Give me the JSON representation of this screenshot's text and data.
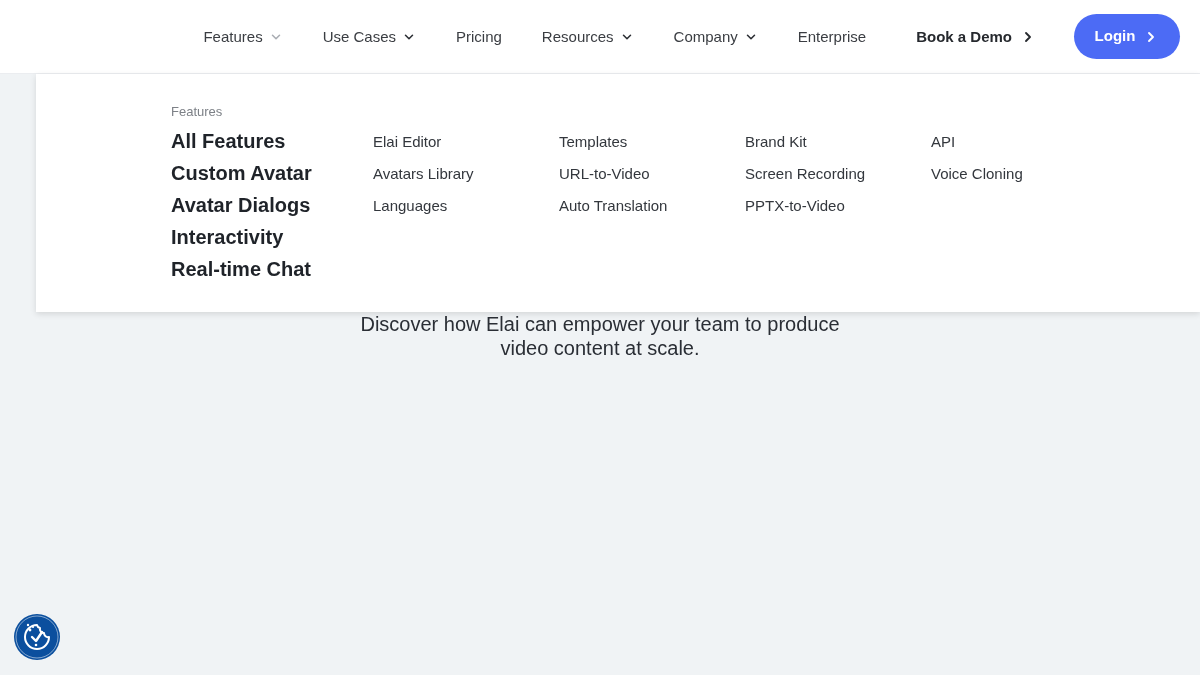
{
  "nav": {
    "items": [
      {
        "label": "Features",
        "kind": "dropdown",
        "expanded": true
      },
      {
        "label": "Use Cases",
        "kind": "dropdown",
        "expanded": false
      },
      {
        "label": "Pricing",
        "kind": "link"
      },
      {
        "label": "Resources",
        "kind": "dropdown",
        "expanded": false
      },
      {
        "label": "Company",
        "kind": "dropdown",
        "expanded": false
      },
      {
        "label": "Enterprise",
        "kind": "link"
      }
    ],
    "actions": [
      {
        "label": "Book a Demo",
        "kind": "link"
      },
      {
        "label": "Login",
        "kind": "button"
      }
    ]
  },
  "features_menu": {
    "heading": "Features",
    "primary_links": [
      "All Features",
      "Custom Avatar",
      "Avatar Dialogs",
      "Interactivity",
      "Real-time Chat"
    ],
    "columns": [
      [
        "Elai Editor",
        "Avatars Library",
        "Languages"
      ],
      [
        "Templates",
        "URL-to-Video",
        "Auto Translation"
      ],
      [
        "Brand Kit",
        "Screen Recording",
        "PPTX-to-Video"
      ],
      [
        "API",
        "Voice Cloning"
      ]
    ]
  },
  "hero": {
    "subtitle": "Discover how Elai can empower your team to produce video content at scale."
  }
}
